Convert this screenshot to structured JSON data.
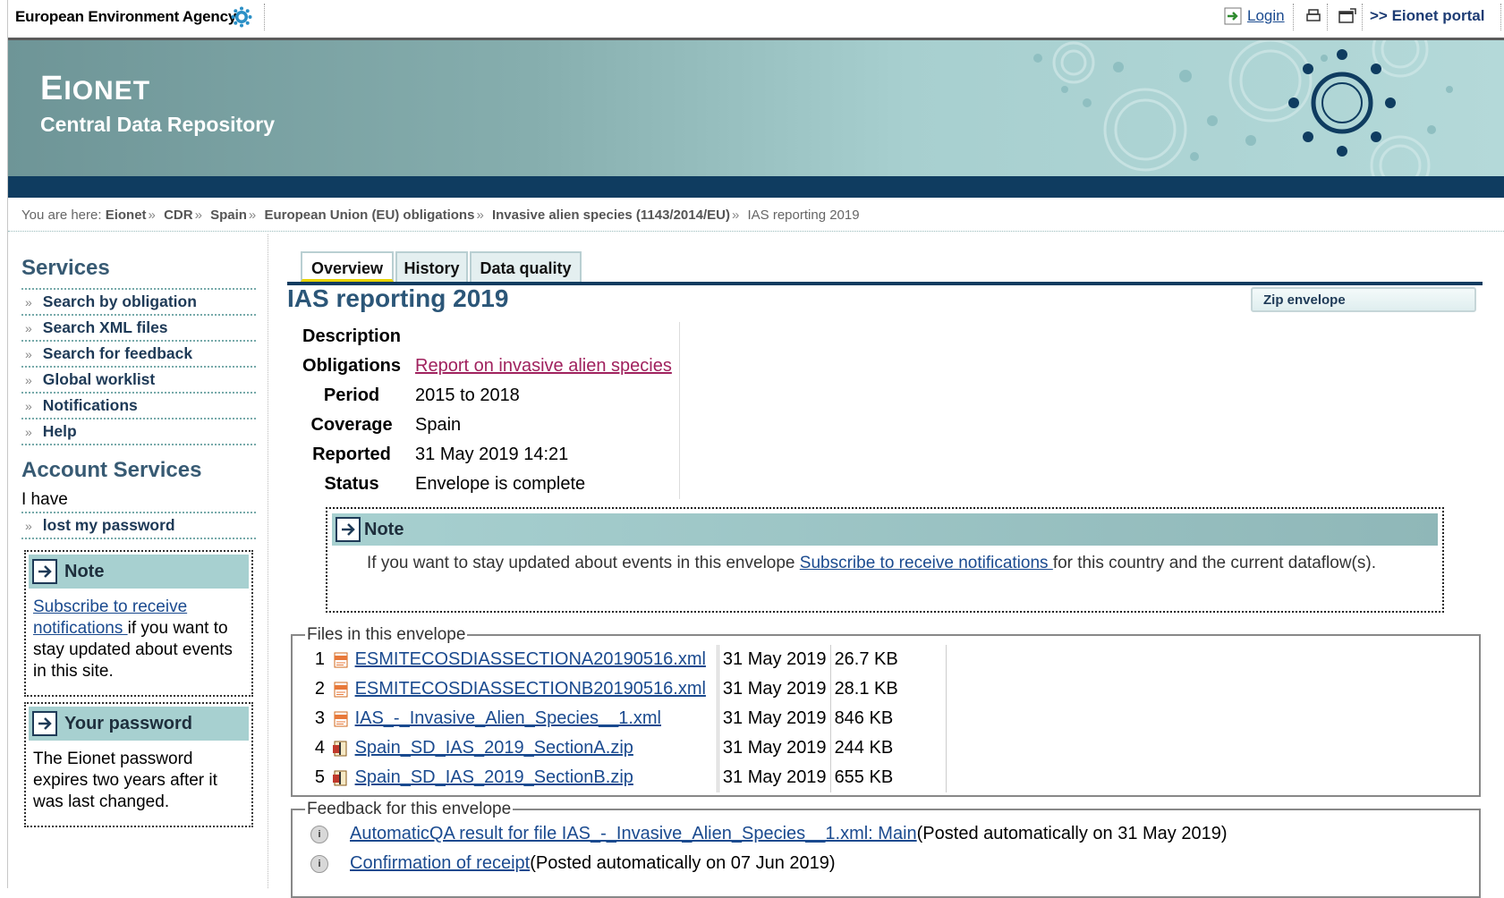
{
  "topbar": {
    "agency": "European Environment Agency",
    "login": "Login",
    "portal": ">> Eionet portal"
  },
  "banner": {
    "title_first": "E",
    "title_rest": "IONET",
    "subtitle": "Central Data Repository"
  },
  "breadcrumb": {
    "prefix": "You are here:",
    "items": [
      "Eionet",
      "CDR",
      "Spain",
      "European Union (EU) obligations",
      "Invasive alien species (1143/2014/EU)"
    ],
    "current": "IAS reporting 2019"
  },
  "sidebar": {
    "services_heading": "Services",
    "services": [
      "Search by obligation",
      "Search XML files",
      "Search for feedback",
      "Global worklist",
      "Notifications",
      "Help"
    ],
    "account_heading": "Account Services",
    "i_have": "I have",
    "lost_password": "lost my password",
    "note_title": "Note",
    "note_link": "Subscribe to receive notifications ",
    "note_text": "if you want to stay updated about events in this site.",
    "pw_title": "Your password",
    "pw_text": "The Eionet password expires two years after it was last changed."
  },
  "tabs": [
    "Overview",
    "History",
    "Data quality"
  ],
  "envelope": {
    "title": "IAS reporting 2019",
    "zip_label": "Zip envelope",
    "meta": {
      "description_label": "Description",
      "description_value": "",
      "obligations_label": "Obligations",
      "obligations_value": "Report on invasive alien species",
      "period_label": "Period",
      "period_value": "2015 to 2018",
      "coverage_label": "Coverage",
      "coverage_value": "Spain",
      "reported_label": "Reported",
      "reported_value": "31 May 2019 14:21",
      "status_label": "Status",
      "status_value": "Envelope is complete"
    }
  },
  "note": {
    "title": "Note",
    "text_before": "If you want to stay updated about events in this envelope ",
    "link": "Subscribe to receive notifications ",
    "text_after": "for this country and the current dataflow(s)."
  },
  "files": {
    "legend": "Files in this envelope",
    "rows": [
      {
        "num": "1",
        "name": "ESMITECOSDIASSECTIONA20190516.xml",
        "date": "31 May 2019",
        "size": "26.7 KB",
        "icon": "xml-file-icon"
      },
      {
        "num": "2",
        "name": "ESMITECOSDIASSECTIONB20190516.xml",
        "date": "31 May 2019",
        "size": "28.1 KB",
        "icon": "xml-file-icon"
      },
      {
        "num": "3",
        "name": "IAS_-_Invasive_Alien_Species__1.xml",
        "date": "31 May 2019",
        "size": "846 KB",
        "icon": "xml-file-icon"
      },
      {
        "num": "4",
        "name": "Spain_SD_IAS_2019_SectionA.zip",
        "date": "31 May 2019",
        "size": "244 KB",
        "icon": "zip-file-icon"
      },
      {
        "num": "5",
        "name": "Spain_SD_IAS_2019_SectionB.zip",
        "date": "31 May 2019",
        "size": "655 KB",
        "icon": "zip-file-icon"
      }
    ]
  },
  "feedback": {
    "legend": "Feedback for this envelope",
    "rows": [
      {
        "link": "AutomaticQA result for file IAS_-_Invasive_Alien_Species__1.xml: Main",
        "note": " (Posted automatically on 31 May 2019)"
      },
      {
        "link": "Confirmation of receipt",
        "note": " (Posted automatically on 07 Jun 2019)"
      }
    ]
  }
}
